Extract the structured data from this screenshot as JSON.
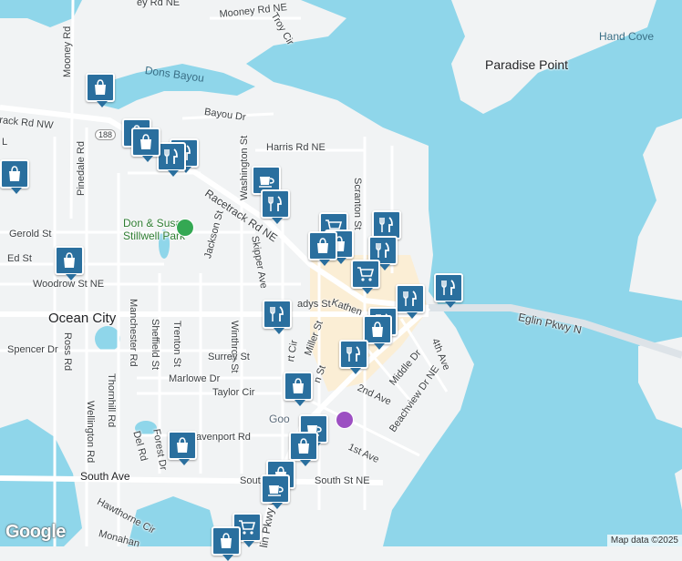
{
  "labels": [
    {
      "key": "mooney_rd_ne_1",
      "text": "ey Rd NE"
    },
    {
      "key": "mooney_rd_ne_2",
      "text": "Mooney Rd NE"
    },
    {
      "key": "troy_cir",
      "text": "Troy Cir"
    },
    {
      "key": "mooney_rd",
      "text": "Mooney Rd"
    },
    {
      "key": "hand_cove",
      "text": "Hand Cove"
    },
    {
      "key": "paradise_point",
      "text": "Paradise Point"
    },
    {
      "key": "dons_bayou",
      "text": "Dons Bayou"
    },
    {
      "key": "racetrack_rd_nw",
      "text": "rack Rd NW"
    },
    {
      "key": "bayou_dr",
      "text": "Bayou Dr"
    },
    {
      "key": "route_188",
      "text": "188"
    },
    {
      "key": "pinedale_rd",
      "text": "Pinedale Rd"
    },
    {
      "key": "harris_rd_ne",
      "text": "Harris Rd NE"
    },
    {
      "key": "washington_st",
      "text": "Washington St"
    },
    {
      "key": "scranton_st",
      "text": "Scranton St"
    },
    {
      "key": "racetrack_rd_ne",
      "text": "Racetrack Rd NE"
    },
    {
      "key": "park_1",
      "text": "Don & Susan"
    },
    {
      "key": "park_2",
      "text": "Stillwell Park"
    },
    {
      "key": "gerold_st",
      "text": "Gerold St"
    },
    {
      "key": "ed_st",
      "text": "Ed St"
    },
    {
      "key": "jackson_st",
      "text": "Jackson St"
    },
    {
      "key": "skipper_ave",
      "text": "Skipper Ave"
    },
    {
      "key": "woodrow_st_ne",
      "text": "Woodrow St NE"
    },
    {
      "key": "ocean_city",
      "text": "Ocean City"
    },
    {
      "key": "gladys_st",
      "text": "adys St"
    },
    {
      "key": "katherine",
      "text": "Kathen"
    },
    {
      "key": "eglin_pkwy_ne",
      "text": "Eglin Pkwy N"
    },
    {
      "key": "spencer_dr",
      "text": "Spencer Dr"
    },
    {
      "key": "ross_rd",
      "text": "Ross Rd"
    },
    {
      "key": "manchester_rd",
      "text": "Manchester Rd"
    },
    {
      "key": "sheffield_st",
      "text": "Sheffield St"
    },
    {
      "key": "trenton_st",
      "text": "Trenton St"
    },
    {
      "key": "winthrop_st",
      "text": "Winthrop St"
    },
    {
      "key": "surrey_st",
      "text": "Surrey St"
    },
    {
      "key": "marlowe_dr",
      "text": "Marlowe Dr"
    },
    {
      "key": "miller_st",
      "text": "Miller St"
    },
    {
      "key": "court_cir",
      "text": "rt Cir"
    },
    {
      "key": "middle_dr",
      "text": "Middle Dr"
    },
    {
      "key": "fourth_ave",
      "text": "4th Ave"
    },
    {
      "key": "beachview_dr_ne",
      "text": "Beachview Dr NE"
    },
    {
      "key": "thornhill_rd",
      "text": "Thornhill Rd"
    },
    {
      "key": "taylor_cir",
      "text": "Taylor Cir"
    },
    {
      "key": "second_ave",
      "text": "2nd Ave"
    },
    {
      "key": "wellington_rd",
      "text": "Wellington Rd"
    },
    {
      "key": "good_poi",
      "text": "Goo"
    },
    {
      "key": "first_ave",
      "text": "1st Ave"
    },
    {
      "key": "davenport_rd",
      "text": "avenport Rd"
    },
    {
      "key": "del_rd",
      "text": "Del Rd"
    },
    {
      "key": "forest_dr",
      "text": "Forest Dr"
    },
    {
      "key": "south_ave",
      "text": "South Ave"
    },
    {
      "key": "south_st_ne",
      "text": "South St NE"
    },
    {
      "key": "south_prefix",
      "text": "South"
    },
    {
      "key": "hawthorne_cir",
      "text": "Hawthorne Cir"
    },
    {
      "key": "eglin_pkwy_vert",
      "text": "lin Pkwy N"
    },
    {
      "key": "monahan",
      "text": "Monahan"
    },
    {
      "key": "l_street",
      "text": "L"
    },
    {
      "key": "middle_st_frag",
      "text": "n St"
    }
  ],
  "markers": [
    {
      "key": "m1",
      "icon": "shopping-bag"
    },
    {
      "key": "m2",
      "icon": "shopping-bag"
    },
    {
      "key": "m3",
      "icon": "shopping-bag"
    },
    {
      "key": "m4",
      "icon": "fork-knife"
    },
    {
      "key": "m5",
      "icon": "fork-knife"
    },
    {
      "key": "m6",
      "icon": "coffee-cup"
    },
    {
      "key": "m7",
      "icon": "coffee-cup"
    },
    {
      "key": "m8",
      "icon": "fork-knife"
    },
    {
      "key": "m9",
      "icon": "shopping-cart"
    },
    {
      "key": "m10",
      "icon": "fork-knife"
    },
    {
      "key": "m11",
      "icon": "shopping-bag"
    },
    {
      "key": "m12",
      "icon": "shopping-bag"
    },
    {
      "key": "m13",
      "icon": "shopping-bag"
    },
    {
      "key": "m14",
      "icon": "fork-knife"
    },
    {
      "key": "m15",
      "icon": "shopping-cart"
    },
    {
      "key": "m16",
      "icon": "fork-knife"
    },
    {
      "key": "m17",
      "icon": "fork-knife"
    },
    {
      "key": "m18",
      "icon": "fork-knife"
    },
    {
      "key": "m19",
      "icon": "fork-knife"
    },
    {
      "key": "m20",
      "icon": "shopping-bag"
    },
    {
      "key": "m21",
      "icon": "fork-knife"
    },
    {
      "key": "m22",
      "icon": "shopping-bag"
    },
    {
      "key": "m23",
      "icon": "coffee-cup"
    },
    {
      "key": "m24",
      "icon": "shopping-bag"
    },
    {
      "key": "m25",
      "icon": "shopping-bag"
    },
    {
      "key": "m26",
      "icon": "shopping-bag"
    },
    {
      "key": "m27",
      "icon": "coffee-cup"
    },
    {
      "key": "m28",
      "icon": "shopping-cart"
    },
    {
      "key": "m29",
      "icon": "shopping-bag"
    }
  ],
  "colors": {
    "water": "#8fd6ea",
    "land": "#f1f3f4",
    "road": "#ffffff",
    "highway": "#dde3e8",
    "marker": "#2a6f9e",
    "park": "#34a853",
    "commercial": "#fbeed5"
  },
  "attribution": {
    "logo": "Google",
    "map_data": "Map data ©2025"
  }
}
